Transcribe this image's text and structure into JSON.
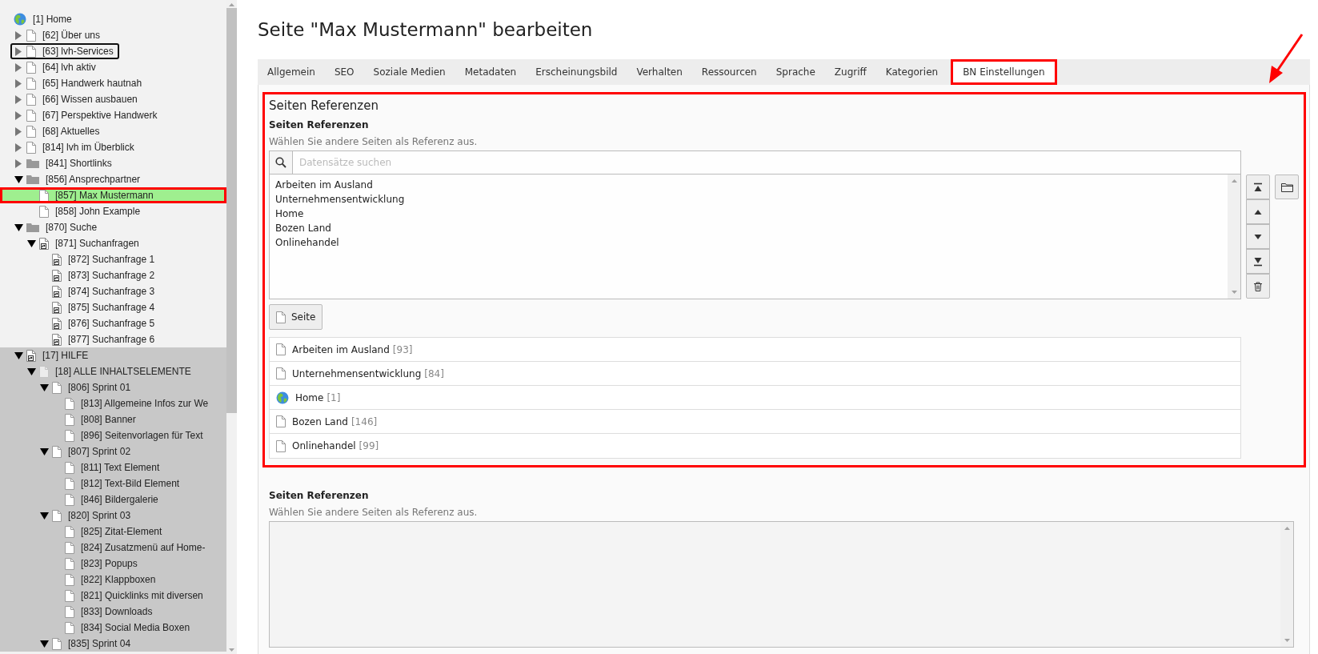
{
  "page_tree": {
    "items": [
      {
        "label": "[1] Home",
        "kind": "globe",
        "selected": false,
        "focused": false,
        "annotated": false,
        "shaded": false,
        "children": [
          {
            "label": "[62] Über uns",
            "kind": "page",
            "expanded": false,
            "selected": false,
            "focused": false,
            "annotated": false,
            "shaded": false
          },
          {
            "label": "[63] lvh-Services",
            "kind": "page",
            "expanded": false,
            "selected": false,
            "focused": true,
            "annotated": false,
            "shaded": false
          },
          {
            "label": "[64] lvh aktiv",
            "kind": "page",
            "expanded": false,
            "selected": false,
            "focused": false,
            "annotated": false,
            "shaded": false
          },
          {
            "label": "[65] Handwerk hautnah",
            "kind": "page",
            "expanded": false,
            "selected": false,
            "focused": false,
            "annotated": false,
            "shaded": false
          },
          {
            "label": "[66] Wissen ausbauen",
            "kind": "page",
            "expanded": false,
            "selected": false,
            "focused": false,
            "annotated": false,
            "shaded": false
          },
          {
            "label": "[67] Perspektive Handwerk",
            "kind": "page",
            "expanded": false,
            "selected": false,
            "focused": false,
            "annotated": false,
            "shaded": false
          },
          {
            "label": "[68] Aktuelles",
            "kind": "page",
            "expanded": false,
            "selected": false,
            "focused": false,
            "annotated": false,
            "shaded": false
          },
          {
            "label": "[814] lvh im Überblick",
            "kind": "page",
            "expanded": false,
            "selected": false,
            "focused": false,
            "annotated": false,
            "shaded": false
          },
          {
            "label": "[841] Shortlinks",
            "kind": "folder",
            "expanded": false,
            "selected": false,
            "focused": false,
            "annotated": false,
            "shaded": false
          },
          {
            "label": "[856] Ansprechpartner",
            "kind": "folder",
            "expanded": true,
            "selected": false,
            "focused": false,
            "annotated": false,
            "shaded": false,
            "children": [
              {
                "label": "[857] Max Mustermann",
                "kind": "page",
                "selected": true,
                "focused": false,
                "annotated": true,
                "shaded": false
              },
              {
                "label": "[858] John Example",
                "kind": "page",
                "selected": false,
                "focused": false,
                "annotated": false,
                "shaded": false
              }
            ]
          },
          {
            "label": "[870] Suche",
            "kind": "folder",
            "expanded": true,
            "selected": false,
            "focused": false,
            "annotated": false,
            "shaded": false,
            "children": [
              {
                "label": "[871] Suchanfragen",
                "kind": "shortcut",
                "expanded": true,
                "selected": false,
                "focused": false,
                "annotated": false,
                "shaded": false,
                "children": [
                  {
                    "label": "[872] Suchanfrage 1",
                    "kind": "shortcut",
                    "selected": false,
                    "focused": false,
                    "annotated": false,
                    "shaded": false
                  },
                  {
                    "label": "[873] Suchanfrage 2",
                    "kind": "shortcut",
                    "selected": false,
                    "focused": false,
                    "annotated": false,
                    "shaded": false
                  },
                  {
                    "label": "[874] Suchanfrage 3",
                    "kind": "shortcut",
                    "selected": false,
                    "focused": false,
                    "annotated": false,
                    "shaded": false
                  },
                  {
                    "label": "[875] Suchanfrage 4",
                    "kind": "shortcut",
                    "selected": false,
                    "focused": false,
                    "annotated": false,
                    "shaded": false
                  },
                  {
                    "label": "[876] Suchanfrage 5",
                    "kind": "shortcut",
                    "selected": false,
                    "focused": false,
                    "annotated": false,
                    "shaded": false
                  },
                  {
                    "label": "[877] Suchanfrage 6",
                    "kind": "shortcut",
                    "selected": false,
                    "focused": false,
                    "annotated": false,
                    "shaded": false
                  }
                ]
              }
            ]
          },
          {
            "label": "[17] HILFE",
            "kind": "shortcut",
            "expanded": true,
            "selected": false,
            "focused": false,
            "annotated": false,
            "shaded": true,
            "children": [
              {
                "label": "[18] ALLE INHALTSELEMENTE",
                "kind": "hidden-page",
                "expanded": true,
                "selected": false,
                "focused": false,
                "annotated": false,
                "shaded": true,
                "children": [
                  {
                    "label": "[806] Sprint 01",
                    "kind": "page",
                    "expanded": true,
                    "selected": false,
                    "focused": false,
                    "annotated": false,
                    "shaded": true,
                    "children": [
                      {
                        "label": "[813] Allgemeine Infos zur We",
                        "kind": "page",
                        "selected": false,
                        "focused": false,
                        "annotated": false,
                        "shaded": true
                      },
                      {
                        "label": "[808] Banner",
                        "kind": "page",
                        "selected": false,
                        "focused": false,
                        "annotated": false,
                        "shaded": true
                      },
                      {
                        "label": "[896] Seitenvorlagen für Text",
                        "kind": "page",
                        "selected": false,
                        "focused": false,
                        "annotated": false,
                        "shaded": true
                      }
                    ]
                  },
                  {
                    "label": "[807] Sprint 02",
                    "kind": "page",
                    "expanded": true,
                    "selected": false,
                    "focused": false,
                    "annotated": false,
                    "shaded": true,
                    "children": [
                      {
                        "label": "[811] Text Element",
                        "kind": "page",
                        "selected": false,
                        "focused": false,
                        "annotated": false,
                        "shaded": true
                      },
                      {
                        "label": "[812] Text-Bild Element",
                        "kind": "page",
                        "selected": false,
                        "focused": false,
                        "annotated": false,
                        "shaded": true
                      },
                      {
                        "label": "[846] Bildergalerie",
                        "kind": "page",
                        "selected": false,
                        "focused": false,
                        "annotated": false,
                        "shaded": true
                      }
                    ]
                  },
                  {
                    "label": "[820] Sprint 03",
                    "kind": "page",
                    "expanded": true,
                    "selected": false,
                    "focused": false,
                    "annotated": false,
                    "shaded": true,
                    "children": [
                      {
                        "label": "[825] Zitat-Element",
                        "kind": "page",
                        "selected": false,
                        "focused": false,
                        "annotated": false,
                        "shaded": true
                      },
                      {
                        "label": "[824] Zusatzmenü auf Home-",
                        "kind": "page",
                        "selected": false,
                        "focused": false,
                        "annotated": false,
                        "shaded": true
                      },
                      {
                        "label": "[823] Popups",
                        "kind": "page",
                        "selected": false,
                        "focused": false,
                        "annotated": false,
                        "shaded": true
                      },
                      {
                        "label": "[822] Klappboxen",
                        "kind": "page",
                        "selected": false,
                        "focused": false,
                        "annotated": false,
                        "shaded": true
                      },
                      {
                        "label": "[821] Quicklinks mit diversen",
                        "kind": "page",
                        "selected": false,
                        "focused": false,
                        "annotated": false,
                        "shaded": true
                      },
                      {
                        "label": "[833] Downloads",
                        "kind": "page",
                        "selected": false,
                        "focused": false,
                        "annotated": false,
                        "shaded": true
                      },
                      {
                        "label": "[834] Social Media Boxen",
                        "kind": "page",
                        "selected": false,
                        "focused": false,
                        "annotated": false,
                        "shaded": true
                      }
                    ]
                  },
                  {
                    "label": "[835] Sprint 04",
                    "kind": "page",
                    "expanded": true,
                    "selected": false,
                    "focused": false,
                    "annotated": false,
                    "shaded": true
                  }
                ]
              }
            ]
          }
        ]
      }
    ]
  },
  "editor": {
    "title": "Seite \"Max Mustermann\" bearbeiten",
    "tabs": [
      {
        "label": "Allgemein",
        "selected": false,
        "annotated": false
      },
      {
        "label": "SEO",
        "selected": false,
        "annotated": false
      },
      {
        "label": "Soziale Medien",
        "selected": false,
        "annotated": false
      },
      {
        "label": "Metadaten",
        "selected": false,
        "annotated": false
      },
      {
        "label": "Erscheinungsbild",
        "selected": false,
        "annotated": false
      },
      {
        "label": "Verhalten",
        "selected": false,
        "annotated": false
      },
      {
        "label": "Ressourcen",
        "selected": false,
        "annotated": false
      },
      {
        "label": "Sprache",
        "selected": false,
        "annotated": false
      },
      {
        "label": "Zugriff",
        "selected": false,
        "annotated": false
      },
      {
        "label": "Kategorien",
        "selected": false,
        "annotated": false
      },
      {
        "label": "BN Einstellungen",
        "selected": true,
        "annotated": true
      }
    ],
    "reference_group": {
      "legend": "Seiten Referenzen",
      "annotated": true,
      "callout_arrow": true,
      "label": "Seiten Referenzen",
      "description": "Wählen Sie andere Seiten als Referenz aus.",
      "search": {
        "placeholder": "Datensätze suchen"
      },
      "selected_items": [
        {
          "label": "Arbeiten im Ausland",
          "selected": false
        },
        {
          "label": "Unternehmensentwicklung",
          "selected": false
        },
        {
          "label": "Home",
          "selected": false
        },
        {
          "label": "Bozen Land",
          "selected": false
        },
        {
          "label": "Onlinehandel",
          "selected": false
        }
      ],
      "add_button": "Seite",
      "references": [
        {
          "title": "Arbeiten im Ausland",
          "uid": "[93]",
          "kind": "page"
        },
        {
          "title": "Unternehmensentwicklung",
          "uid": "[84]",
          "kind": "page"
        },
        {
          "title": "Home",
          "uid": "[1]",
          "kind": "globe"
        },
        {
          "title": "Bozen Land",
          "uid": "[146]",
          "kind": "page"
        },
        {
          "title": "Onlinehandel",
          "uid": "[99]",
          "kind": "page"
        }
      ]
    },
    "second_field": {
      "label": "Seiten Referenzen",
      "description": "Wählen Sie andere Seiten als Referenz aus."
    }
  }
}
